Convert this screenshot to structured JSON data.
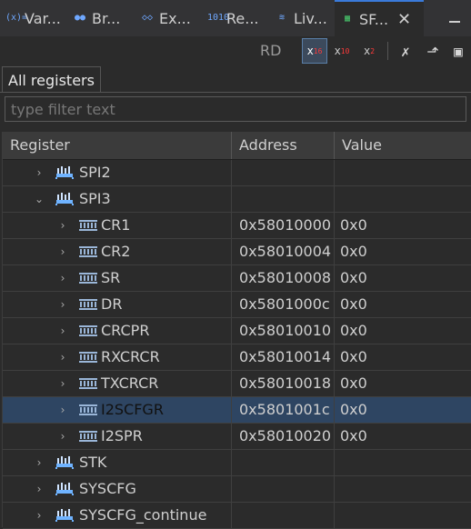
{
  "tabs": [
    {
      "icon": "(x)=",
      "label": "Var..."
    },
    {
      "icon": "●●",
      "label": "Br..."
    },
    {
      "icon": "◇◇",
      "label": "Ex..."
    },
    {
      "icon": "1010",
      "label": "Re..."
    },
    {
      "icon": "≋",
      "label": "Liv..."
    },
    {
      "icon": "▦",
      "label": "SF..."
    }
  ],
  "toolbar": {
    "rd_label": "RD",
    "hex_label": "x",
    "hex_sub": "16",
    "dec_label": "x",
    "dec_sub": "10",
    "bin_label": "x",
    "bin_sub": "2"
  },
  "panel": {
    "tab_label": "All registers",
    "filter_placeholder": "type filter text"
  },
  "table": {
    "headers": {
      "register": "Register",
      "address": "Address",
      "value": "Value"
    },
    "rows": [
      {
        "name": "SPI2",
        "address": "",
        "value": "",
        "twisty": "›"
      },
      {
        "name": "SPI3",
        "address": "",
        "value": "",
        "twisty": "⌄"
      },
      {
        "name": "CR1",
        "address": "0x58010000",
        "value": "0x0",
        "twisty": "›"
      },
      {
        "name": "CR2",
        "address": "0x58010004",
        "value": "0x0",
        "twisty": "›"
      },
      {
        "name": "SR",
        "address": "0x58010008",
        "value": "0x0",
        "twisty": "›"
      },
      {
        "name": "DR",
        "address": "0x5801000c",
        "value": "0x0",
        "twisty": "›"
      },
      {
        "name": "CRCPR",
        "address": "0x58010010",
        "value": "0x0",
        "twisty": "›"
      },
      {
        "name": "RXCRCR",
        "address": "0x58010014",
        "value": "0x0",
        "twisty": "›"
      },
      {
        "name": "TXCRCR",
        "address": "0x58010018",
        "value": "0x0",
        "twisty": "›"
      },
      {
        "name": "I2SCFGR",
        "address": "0x5801001c",
        "value": "0x0",
        "twisty": "›"
      },
      {
        "name": "I2SPR",
        "address": "0x58010020",
        "value": "0x0",
        "twisty": "›"
      },
      {
        "name": "STK",
        "address": "",
        "value": "",
        "twisty": "›"
      },
      {
        "name": "SYSCFG",
        "address": "",
        "value": "",
        "twisty": "›"
      },
      {
        "name": "SYSCFG_continue",
        "address": "",
        "value": "",
        "twisty": "›"
      }
    ]
  },
  "colors": {
    "selected_row": "#2e4562",
    "accent": "#3a7ad9"
  }
}
